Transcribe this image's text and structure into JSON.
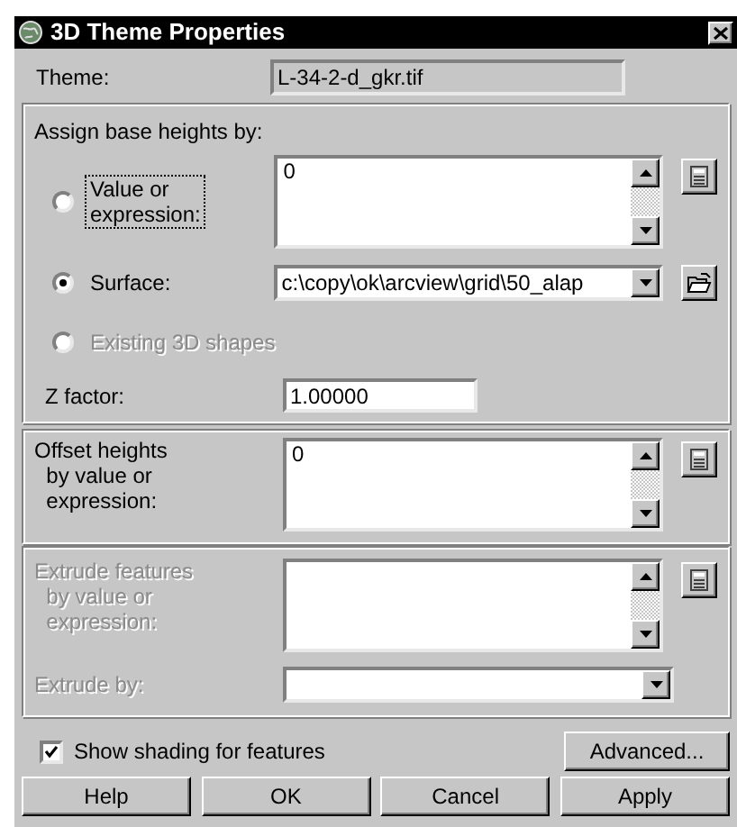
{
  "window": {
    "title": "3D Theme Properties"
  },
  "theme": {
    "label": "Theme:",
    "value": "L-34-2-d_gkr.tif"
  },
  "base_heights": {
    "title": "Assign base heights by:",
    "options": [
      {
        "kind": "expression",
        "label": "Value or\nexpression:",
        "selected": false,
        "disabled": false,
        "focused": true,
        "value": "0"
      },
      {
        "kind": "surface",
        "label": "Surface:",
        "selected": true,
        "disabled": false,
        "focused": false,
        "value": "c:\\copy\\ok\\arcview\\grid\\50_alap"
      },
      {
        "kind": "plain",
        "label": "Existing 3D shapes",
        "selected": false,
        "disabled": true,
        "focused": false
      }
    ],
    "z_factor": {
      "label": "Z factor:",
      "value": "1.00000"
    }
  },
  "offset": {
    "label": "Offset heights\n  by value or\n  expression:",
    "value": "0",
    "disabled": false
  },
  "extrude": {
    "label": "Extrude features\n  by value or\n  expression:",
    "disabled": true,
    "by_label": "Extrude by:"
  },
  "shading": {
    "label": "Show shading for features",
    "checked": true
  },
  "advanced": "Advanced...",
  "buttons": [
    "Help",
    "OK",
    "Cancel",
    "Apply"
  ]
}
